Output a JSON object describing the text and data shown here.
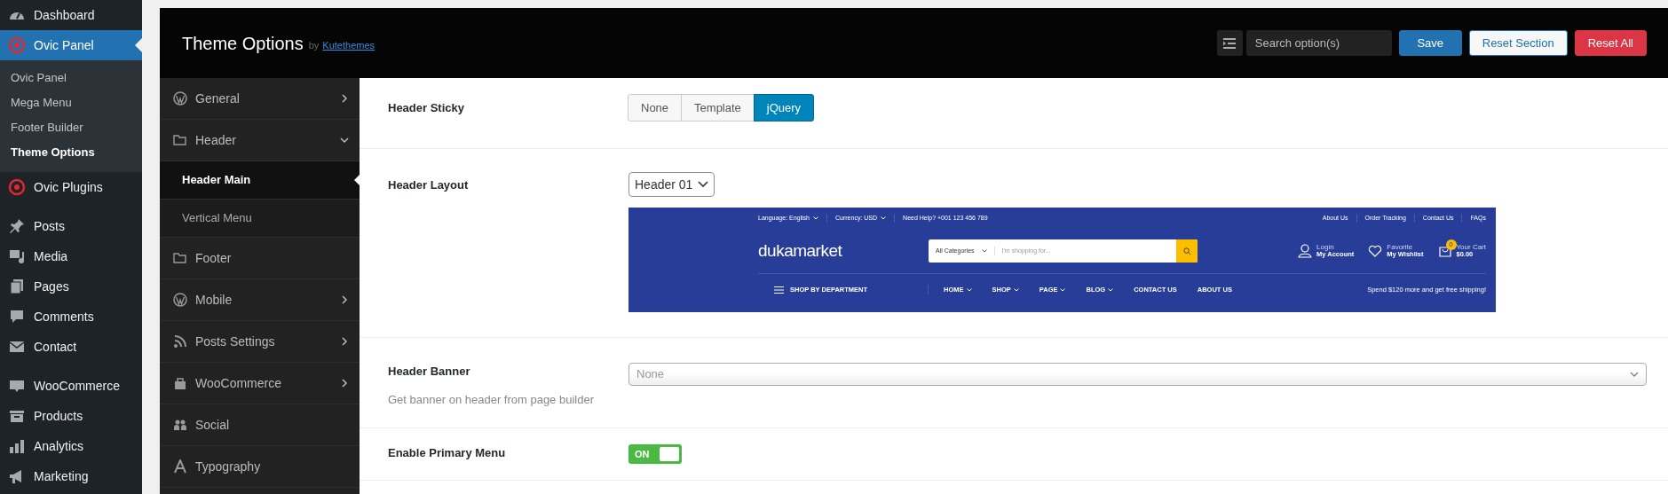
{
  "admin_menu": {
    "groups": [
      [
        {
          "label": "Dashboard",
          "selected": false
        },
        {
          "label": "Ovic Panel",
          "selected": true,
          "children": [
            {
              "label": "Ovic Panel",
              "selected": false
            },
            {
              "label": "Mega Menu",
              "selected": false
            },
            {
              "label": "Footer Builder",
              "selected": false
            },
            {
              "label": "Theme Options",
              "selected": true
            }
          ]
        },
        {
          "label": "Ovic Plugins",
          "selected": false
        }
      ],
      [
        {
          "label": "Posts",
          "selected": false
        },
        {
          "label": "Media",
          "selected": false
        },
        {
          "label": "Pages",
          "selected": false
        },
        {
          "label": "Comments",
          "selected": false
        },
        {
          "label": "Contact",
          "selected": false
        }
      ],
      [
        {
          "label": "WooCommerce",
          "selected": false
        },
        {
          "label": "Products",
          "selected": false
        },
        {
          "label": "Analytics",
          "selected": false
        },
        {
          "label": "Marketing",
          "selected": false
        }
      ]
    ]
  },
  "panel": {
    "title": "Theme Options",
    "byline": "by",
    "author_link": "Kutethemes",
    "search": {
      "placeholder": "Search option(s)"
    },
    "buttons": [
      {
        "label": "Save",
        "kind": "primary"
      },
      {
        "label": "Reset Section",
        "kind": "outline"
      },
      {
        "label": "Reset All",
        "kind": "danger"
      }
    ]
  },
  "sections": [
    {
      "label": "General",
      "expanded": false,
      "selected": false
    },
    {
      "label": "Header",
      "expanded": true,
      "selected": false,
      "children": [
        {
          "label": "Header Main",
          "selected": true
        },
        {
          "label": "Vertical Menu",
          "selected": false
        }
      ]
    },
    {
      "label": "Footer",
      "selected": false
    },
    {
      "label": "Mobile",
      "expanded": false,
      "selected": false
    },
    {
      "label": "Posts Settings",
      "expanded": false,
      "selected": false
    },
    {
      "label": "WooCommerce",
      "expanded": false,
      "selected": false
    },
    {
      "label": "Social",
      "selected": false
    },
    {
      "label": "Typography",
      "selected": false
    }
  ],
  "fields": [
    {
      "kind": "button_set",
      "label": "Header Sticky",
      "options": [
        {
          "label": "None",
          "selected": false
        },
        {
          "label": "Template",
          "selected": false
        },
        {
          "label": "jQuery",
          "selected": true
        }
      ]
    },
    {
      "kind": "layout",
      "label": "Header Layout",
      "value": "Header 01",
      "preview": {
        "top_left": [
          {
            "text": "Language: English",
            "dropdown": true
          },
          {
            "text": "Currency: USD",
            "dropdown": true
          },
          {
            "text": "Need Help? +001 123 456 789",
            "dropdown": false
          }
        ],
        "top_right": [
          "About Us",
          "Order Tracking",
          "Contact Us",
          "FAQs"
        ],
        "logo": "dukamarket",
        "search": {
          "category": "All Categories",
          "placeholder": "I'm shopping for..."
        },
        "actions": [
          {
            "caption": "Login",
            "label": "My Account"
          },
          {
            "caption": "Favorite",
            "label": "My Wishlist"
          },
          {
            "caption": "Your Cart",
            "label": "$0.00",
            "count": "0"
          }
        ],
        "department": "SHOP BY DEPARTMENT",
        "menu": [
          {
            "text": "HOME",
            "dropdown": true
          },
          {
            "text": "SHOP",
            "dropdown": true
          },
          {
            "text": "PAGE",
            "dropdown": true
          },
          {
            "text": "BLOG",
            "dropdown": true
          },
          {
            "text": "CONTACT US",
            "dropdown": false
          },
          {
            "text": "ABOUT US",
            "dropdown": false
          }
        ],
        "promo": "Spend $120 more and get free shipping!"
      }
    },
    {
      "kind": "select",
      "label": "Header Banner",
      "description": "Get banner on header from page builder",
      "value": "None"
    },
    {
      "kind": "switch",
      "label": "Enable Primary Menu",
      "on": true,
      "text": "ON"
    }
  ]
}
